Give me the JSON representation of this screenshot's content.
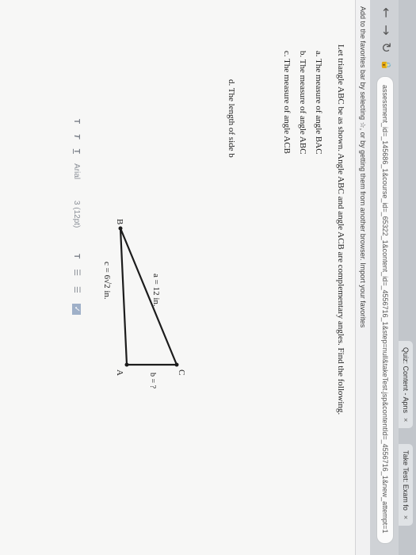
{
  "browser": {
    "tabs": [
      {
        "label": "Quiz: Content - Apns",
        "close": "×"
      },
      {
        "label": "Take Test: Exam fo",
        "close": "×"
      }
    ],
    "nav": {
      "back": "←",
      "forward": "→",
      "refresh": "↻",
      "lock": "🔒"
    },
    "address": "assessment_id=_145686_1&course_id=_65322_1&content_id=_4556716_1&step=null&takeTest.jsp&contentId=_4556716_1&new_attempt=1",
    "favorites_bar": "Add to the favorites bar by selecting ☆, or by getting them from another browser. Import your favorites"
  },
  "question": {
    "intro": "Let triangle ABC be as shown. Angle ABC and angle ACB are complementary angles. Find the following.",
    "parts": [
      "a. The measure of angle BAC",
      "b. The measure of angle ABC",
      "c. The measure of angle ACB",
      "d. The length of side b"
    ]
  },
  "diagram": {
    "vertex_a": "A",
    "vertex_b": "B",
    "vertex_c": "C",
    "side_a": "a = 12 in.",
    "side_b": "b = ?",
    "side_c": "c = 6√2 in."
  },
  "toolbar": {
    "t1": "T",
    "t2": "T",
    "t3": "T",
    "font": "Arial",
    "size": "3 (12pt)",
    "t4": "T",
    "list1": "☰",
    "list2": "☰",
    "accent": "#9fb0c8"
  }
}
